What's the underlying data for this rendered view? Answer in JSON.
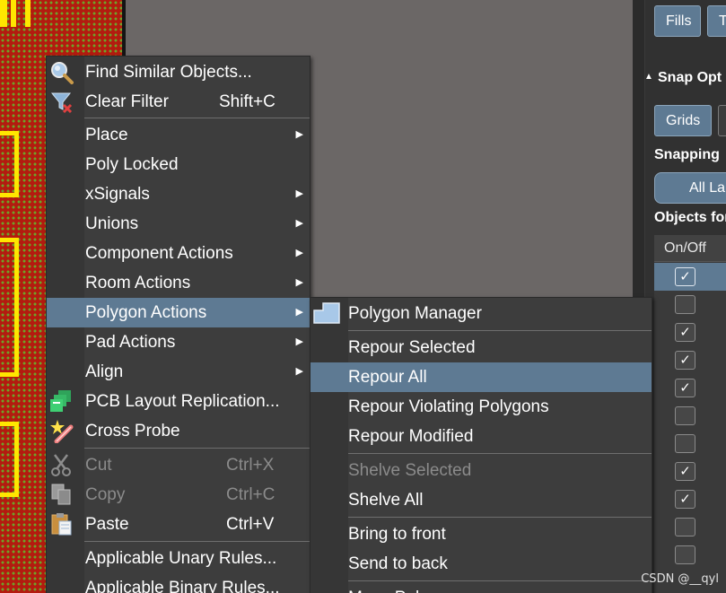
{
  "panel": {
    "fills_button": "Fills",
    "second_button_partial": "T",
    "section_title": "Snap Opt",
    "section_arrow": "▲",
    "grids_button": "Grids",
    "snapping_label": "Snapping",
    "all_layers_button": "All La",
    "objects_label": "Objects for",
    "table_header": "On/Off",
    "rows": [
      {
        "checked": true,
        "selected": true
      },
      {
        "checked": false
      },
      {
        "checked": true
      },
      {
        "checked": true
      },
      {
        "checked": true
      },
      {
        "checked": false
      },
      {
        "checked": false
      },
      {
        "checked": true
      },
      {
        "checked": true
      },
      {
        "checked": false
      },
      {
        "checked": false
      }
    ]
  },
  "context_menu": {
    "items": [
      {
        "label": "Find Similar Objects...",
        "icon": "magnifier-icon"
      },
      {
        "label": "Clear Filter",
        "shortcut": "Shift+C",
        "icon": "clear-filter-icon"
      },
      {
        "label": "Place",
        "submenu": true
      },
      {
        "label": "Poly Locked"
      },
      {
        "label": "xSignals",
        "submenu": true
      },
      {
        "label": "Unions",
        "submenu": true
      },
      {
        "label": "Component Actions",
        "submenu": true
      },
      {
        "label": "Room Actions",
        "submenu": true
      },
      {
        "label": "Polygon Actions",
        "submenu": true,
        "highlighted": true
      },
      {
        "label": "Pad Actions",
        "submenu": true
      },
      {
        "label": "Align",
        "submenu": true
      },
      {
        "label": "PCB Layout Replication...",
        "icon": "layout-replication-icon"
      },
      {
        "label": "Cross Probe",
        "icon": "cross-probe-icon"
      },
      {
        "label": "Cut",
        "shortcut": "Ctrl+X",
        "disabled": true,
        "icon": "scissors-icon"
      },
      {
        "label": "Copy",
        "shortcut": "Ctrl+C",
        "disabled": true,
        "icon": "copy-icon"
      },
      {
        "label": "Paste",
        "shortcut": "Ctrl+V",
        "icon": "paste-icon"
      },
      {
        "label": "Applicable Unary Rules..."
      },
      {
        "label": "Applicable Binary Rules..."
      }
    ]
  },
  "submenu": {
    "items": [
      {
        "label": "Polygon Manager",
        "icon": "polygon-manager-icon"
      },
      {
        "label": "Repour Selected"
      },
      {
        "label": "Repour All",
        "highlighted": true
      },
      {
        "label": "Repour Violating Polygons"
      },
      {
        "label": "Repour Modified"
      },
      {
        "label": "Shelve Selected",
        "disabled": true
      },
      {
        "label": "Shelve All"
      },
      {
        "label": "Bring to front"
      },
      {
        "label": "Send to back"
      },
      {
        "label": "Move Polygon..."
      }
    ]
  },
  "watermark": "CSDN @__qyl",
  "colors": {
    "menu_bg": "#3d3d3d",
    "highlight": "#5e7a93",
    "pcb_copper": "#b31b0f",
    "pcb_outline": "#ffe600",
    "panel_bg": "#313131"
  }
}
